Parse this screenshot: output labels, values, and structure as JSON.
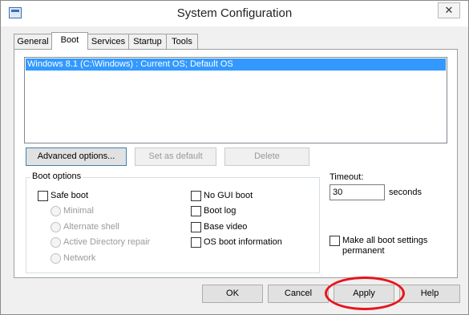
{
  "window": {
    "title": "System Configuration",
    "close_glyph": "✕"
  },
  "tabs": [
    {
      "label": "General"
    },
    {
      "label": "Boot",
      "active": true
    },
    {
      "label": "Services"
    },
    {
      "label": "Startup"
    },
    {
      "label": "Tools"
    }
  ],
  "os_list": [
    "Windows 8.1 (C:\\Windows) : Current OS; Default OS"
  ],
  "boot_buttons": {
    "advanced": "Advanced options...",
    "set_default": "Set as default",
    "delete": "Delete"
  },
  "boot_options": {
    "title": "Boot options",
    "safe_boot": "Safe boot",
    "minimal": "Minimal",
    "alternate_shell": "Alternate shell",
    "active_directory": "Active Directory repair",
    "network": "Network",
    "no_gui": "No GUI boot",
    "boot_log": "Boot log",
    "base_video": "Base video",
    "os_boot_info": "OS boot information"
  },
  "timeout": {
    "label": "Timeout:",
    "value": "30",
    "unit": "seconds"
  },
  "make_permanent": {
    "line1": "Make all boot settings",
    "line2": "permanent"
  },
  "footer": {
    "ok": "OK",
    "cancel": "Cancel",
    "apply": "Apply",
    "help": "Help"
  },
  "colors": {
    "selection": "#3399ff",
    "highlight_ring": "#e8141b"
  }
}
